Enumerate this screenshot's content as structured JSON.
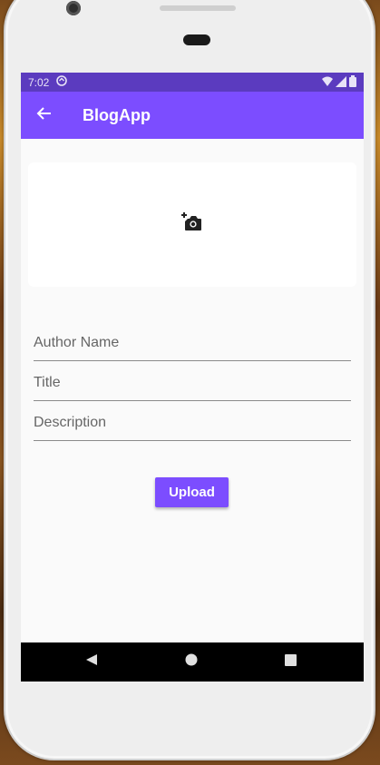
{
  "status_bar": {
    "time": "7:02",
    "icons": [
      "sync-icon",
      "wifi-icon",
      "signal-icon",
      "battery-icon"
    ]
  },
  "app_bar": {
    "title": "BlogApp",
    "back_icon": "arrow-back-icon",
    "color": "#7c4dff"
  },
  "image_picker": {
    "icon": "add-photo-icon"
  },
  "form": {
    "author_placeholder": "Author Name",
    "title_placeholder": "Title",
    "description_placeholder": "Description"
  },
  "upload_button": {
    "label": "Upload"
  },
  "nav_bar": {
    "items": [
      "back-triangle-icon",
      "home-circle-icon",
      "recents-square-icon"
    ]
  },
  "colors": {
    "accent": "#7c4dff",
    "status_bar": "#5b3bbf",
    "background": "#fafafa"
  }
}
